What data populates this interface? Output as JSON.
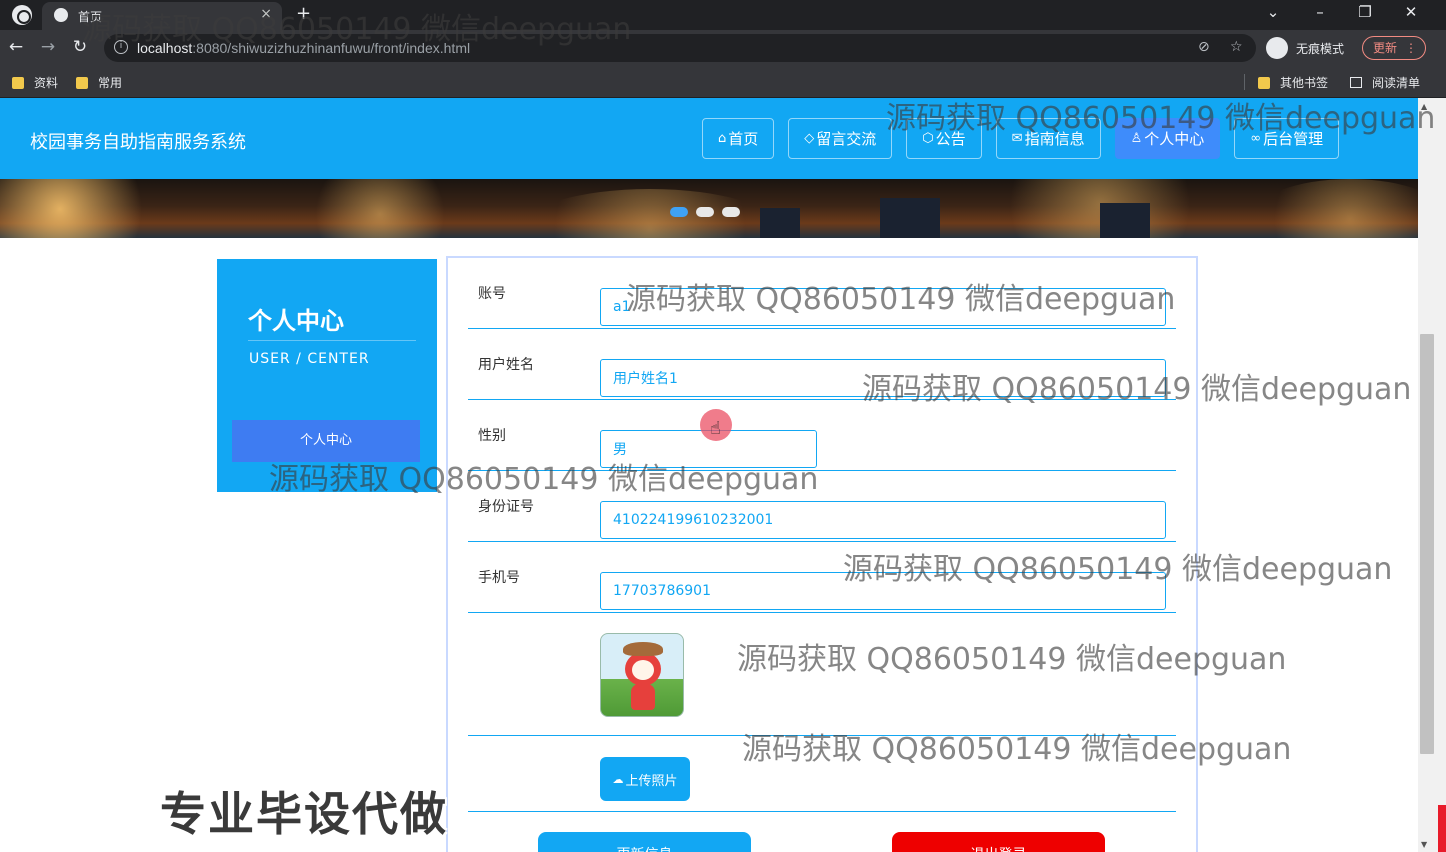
{
  "browser": {
    "tab_title": "首页",
    "tab_close": "×",
    "new_tab": "+",
    "url_host": "localhost",
    "url_rest": ":8080/shiwuzizhuzhinanfuwu/front/index.html",
    "incognito_label": "无痕模式",
    "update_label": "更新",
    "bookmarks": [
      "资料",
      "常用"
    ],
    "other_bookmarks": "其他书签",
    "reading_list": "阅读清单"
  },
  "site": {
    "title": "校园事务自助指南服务系统",
    "nav": [
      {
        "icon": "⌂",
        "label": "首页",
        "icon_name": "home-icon"
      },
      {
        "icon": "◇",
        "label": "留言交流",
        "icon_name": "tag-icon"
      },
      {
        "icon": "⬡",
        "label": "公告",
        "icon_name": "box-icon"
      },
      {
        "icon": "✉",
        "label": "指南信息",
        "icon_name": "mail-icon"
      },
      {
        "icon": "♙",
        "label": "个人中心",
        "icon_name": "user-icon",
        "active": true
      },
      {
        "icon": "∞",
        "label": "后台管理",
        "icon_name": "link-icon"
      }
    ]
  },
  "sidebar": {
    "title": "个人中心",
    "subtitle": "USER / CENTER",
    "item": "个人中心"
  },
  "form": {
    "account_label": "账号",
    "account_value": "a1",
    "name_label": "用户姓名",
    "name_value": "用户姓名1",
    "gender_label": "性别",
    "gender_value": "男",
    "idcard_label": "身份证号",
    "idcard_value": "410224199610232001",
    "phone_label": "手机号",
    "phone_value": "17703786901",
    "upload_label": "上传照片",
    "update_button": "更新信息",
    "logout_button": "退出登录"
  },
  "overlay": {
    "watermark": "源码获取 QQ86050149 微信deepguan",
    "stamp": "专业毕设代做"
  },
  "colors": {
    "brand": "#12a7f3",
    "active": "#3e8cfb",
    "logout": "#ee0000"
  }
}
